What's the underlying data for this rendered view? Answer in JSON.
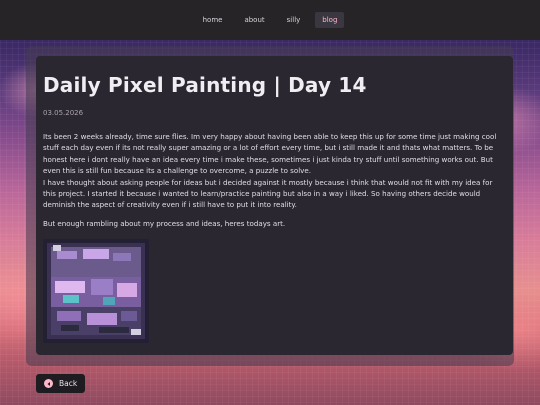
{
  "nav": {
    "items": [
      {
        "label": "home",
        "active": false
      },
      {
        "label": "about",
        "active": false
      },
      {
        "label": "silly",
        "active": false
      },
      {
        "label": "blog",
        "active": true
      }
    ]
  },
  "post": {
    "title": "Daily Pixel Painting | Day 14",
    "date": "03.05.2026",
    "paragraph_1": "Its been 2 weeks already, time sure flies. Im very happy about having been able to keep this up for some time just making cool stuff each day even if its not really super amazing or a lot of effort every time, but i still made it and thats what matters. To be honest here i dont really have an idea every time i make these, sometimes i just kinda try stuff until something works out. But even this is still fun because its a challenge to overcome, a puzzle to solve.",
    "paragraph_2": "I have thought about asking people for ideas but i decided against it mostly because i think that would not fit with my idea for this project. I started it because i wanted to learn/practice painting but also in a way i liked. So having others decide would deminish the aspect of creativity even if i still have to put it into reality.",
    "paragraph_3": "But enough rambling about my process and ideas, heres todays art."
  },
  "back_button": {
    "label": "Back"
  },
  "colors": {
    "accent": "#ffb7c9",
    "panel": "#2b2730",
    "topbar": "#262427"
  }
}
